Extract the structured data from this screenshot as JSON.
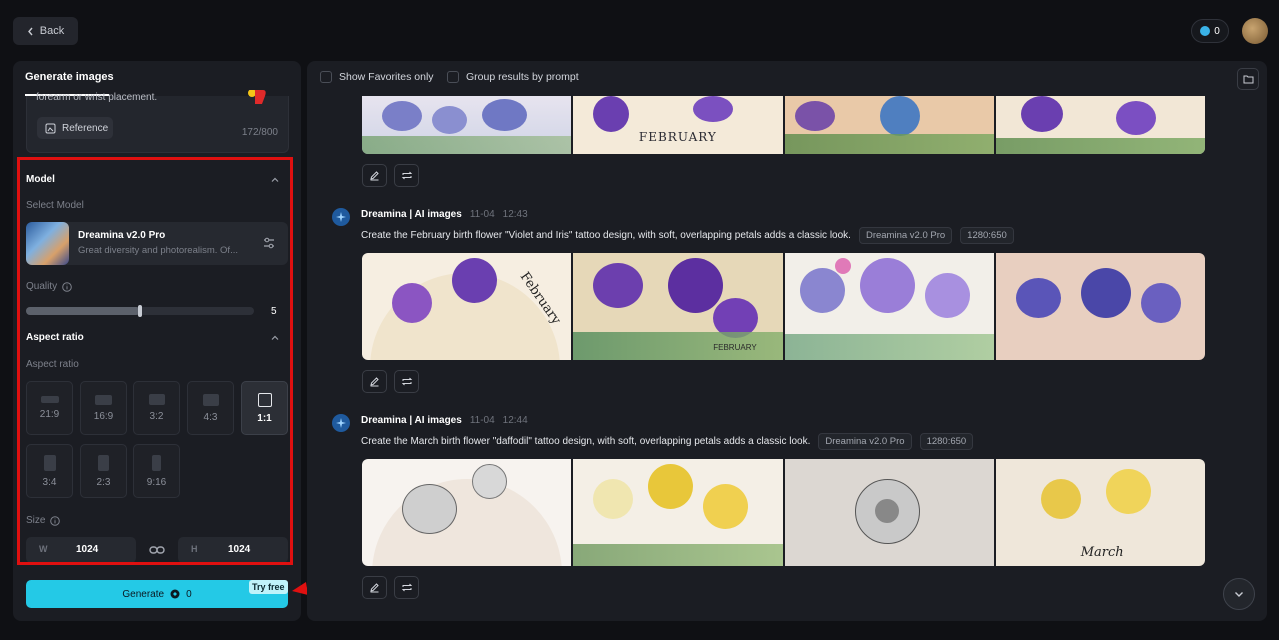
{
  "topbar": {
    "back_label": "Back",
    "credits": "0"
  },
  "left": {
    "tab_label": "Generate images",
    "prompt_snippet": "forearm or wrist placement.",
    "reference_label": "Reference",
    "char_count": "172/800",
    "model_section": "Model",
    "select_model_label": "Select Model",
    "model_name": "Dreamina v2.0 Pro",
    "model_desc": "Great diversity and photorealism. Of...",
    "quality_label": "Quality",
    "quality_value": "5",
    "quality_fraction": 0.5,
    "aspect_section": "Aspect ratio",
    "aspect_sub": "Aspect ratio",
    "ratios": [
      "21:9",
      "16:9",
      "3:2",
      "4:3",
      "1:1",
      "3:4",
      "2:3",
      "9:16"
    ],
    "selected_ratio": "1:1",
    "size_label": "Size",
    "width_prefix": "W",
    "width_value": "1024",
    "height_prefix": "H",
    "height_value": "1024",
    "generate_label": "Generate",
    "generate_credits": "0",
    "try_free": "Try free"
  },
  "right": {
    "show_favorites": "Show Favorites only",
    "group_by_prompt": "Group results by prompt",
    "top_row_text": "FEBRUARY",
    "messages": [
      {
        "author": "Dreamina | AI images",
        "date": "11-04",
        "time": "12:43",
        "prompt": "Create the February birth flower  \"Violet and Iris\" tattoo design, with soft, overlapping petals adds a classic look.",
        "model_tag": "Dreamina v2.0 Pro",
        "size_tag": "1280:650",
        "image_labels": [
          "February",
          "FEBRUARY"
        ]
      },
      {
        "author": "Dreamina | AI images",
        "date": "11-04",
        "time": "12:44",
        "prompt": "Create the March birth flower  \"daffodil\" tattoo design, with soft, overlapping petals adds a classic look.",
        "model_tag": "Dreamina v2.0 Pro",
        "size_tag": "1280:650",
        "image_labels": [
          "March"
        ]
      }
    ]
  },
  "colors": {
    "accent": "#24c9e6",
    "highlight": "#e01010",
    "panel": "#1b1d23",
    "background": "#0f1014"
  }
}
